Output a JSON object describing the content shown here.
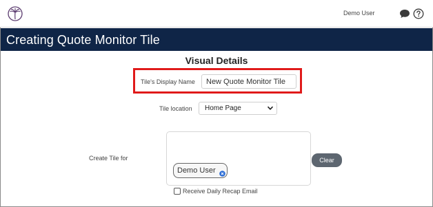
{
  "header": {
    "user_name": "Demo User"
  },
  "page": {
    "title": "Creating Quote Monitor Tile",
    "section_title": "Visual Details"
  },
  "form": {
    "display_name": {
      "label": "Tile's Display Name",
      "value": "New Quote Monitor Tile"
    },
    "location": {
      "label": "Tile location",
      "selected": "Home Page"
    },
    "create_for": {
      "label": "Create Tile for",
      "chips": [
        "Demo User"
      ],
      "clear_label": "Clear"
    },
    "recap": {
      "label": "Receive Daily Recap Email",
      "checked": false
    }
  },
  "icons": {
    "logo": "palm-tree-logo-icon",
    "chat": "chat-bubble-icon",
    "help": "help-question-icon",
    "chip_remove": "remove-x-icon",
    "select": "chevron-down-icon"
  },
  "colors": {
    "banner": "#0f2547",
    "highlight": "#e01a1a",
    "clear_button": "#5d6670",
    "chip_remove": "#2f6fd6"
  }
}
